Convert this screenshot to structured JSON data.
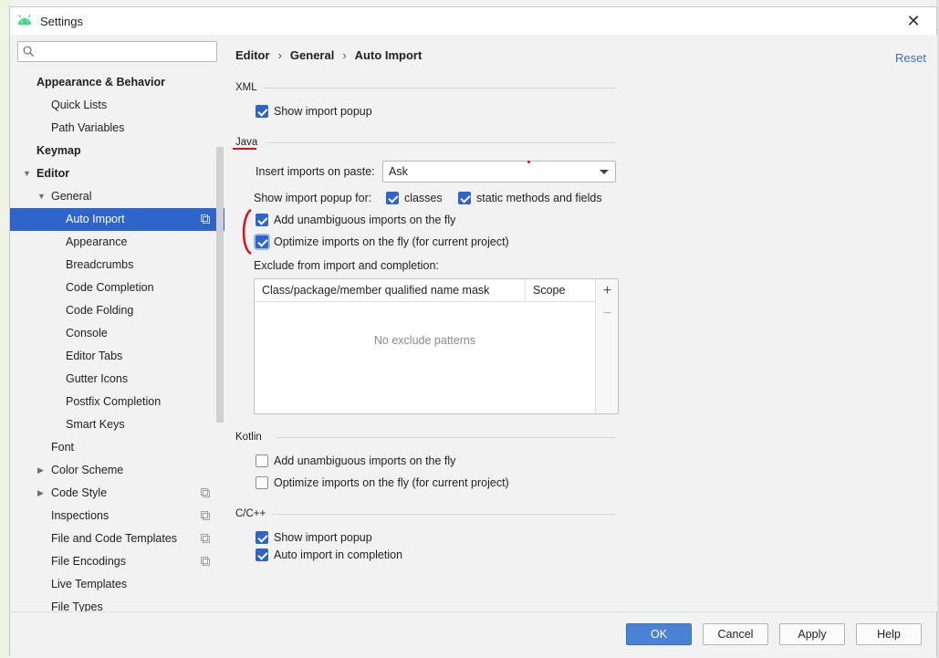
{
  "window": {
    "title": "Settings",
    "close_glyph": "✕"
  },
  "sidebar": {
    "search": {
      "value": "",
      "placeholder": ""
    },
    "items": [
      {
        "label": "Appearance & Behavior",
        "bold": true
      },
      {
        "label": "Quick Lists"
      },
      {
        "label": "Path Variables"
      },
      {
        "label": "Keymap",
        "bold": true
      },
      {
        "label": "Editor",
        "bold": true,
        "expanded": true
      },
      {
        "label": "General",
        "expanded": true
      },
      {
        "label": "Auto Import",
        "selected": true
      },
      {
        "label": "Appearance"
      },
      {
        "label": "Breadcrumbs"
      },
      {
        "label": "Code Completion"
      },
      {
        "label": "Code Folding"
      },
      {
        "label": "Console"
      },
      {
        "label": "Editor Tabs"
      },
      {
        "label": "Gutter Icons"
      },
      {
        "label": "Postfix Completion"
      },
      {
        "label": "Smart Keys"
      },
      {
        "label": "Font"
      },
      {
        "label": "Color Scheme"
      },
      {
        "label": "Code Style"
      },
      {
        "label": "Inspections"
      },
      {
        "label": "File and Code Templates"
      },
      {
        "label": "File Encodings"
      },
      {
        "label": "Live Templates"
      },
      {
        "label": "File Types"
      }
    ]
  },
  "content": {
    "breadcrumb": [
      "Editor",
      "General",
      "Auto Import"
    ],
    "breadcrumb_sep": "›",
    "reset_label": "Reset",
    "xml": {
      "title": "XML",
      "show_import_popup": {
        "label": "Show import popup",
        "checked": true
      }
    },
    "java": {
      "title": "Java",
      "insert_imports_label": "Insert imports on paste:",
      "insert_imports_value": "Ask",
      "show_popup_for_label": "Show import popup for:",
      "classes": {
        "label": "classes",
        "checked": true
      },
      "static_methods": {
        "label": "static methods and fields",
        "checked": true
      },
      "add_unambiguous": {
        "label": "Add unambiguous imports on the fly",
        "checked": true
      },
      "optimize_imports": {
        "label": "Optimize imports on the fly (for current project)",
        "checked": true
      },
      "exclude_label": "Exclude from import and completion:",
      "table": {
        "columns": [
          "Class/package/member qualified name mask",
          "Scope"
        ],
        "empty_text": "No exclude patterns",
        "add_glyph": "+",
        "remove_glyph": "−"
      }
    },
    "kotlin": {
      "title": "Kotlin",
      "add_unambiguous": {
        "label": "Add unambiguous imports on the fly",
        "checked": false
      },
      "optimize_imports": {
        "label": "Optimize imports on the fly (for current project)",
        "checked": false
      }
    },
    "cpp": {
      "title": "C/C++",
      "show_import_popup": {
        "label": "Show import popup",
        "checked": true
      },
      "auto_import": {
        "label": "Auto import in completion",
        "checked": true
      }
    }
  },
  "footer": {
    "ok": "OK",
    "cancel": "Cancel",
    "apply": "Apply",
    "help": "Help"
  },
  "colors": {
    "accent": "#2f65ca",
    "annotation": "#d9101f",
    "link": "#3d6fb8"
  }
}
